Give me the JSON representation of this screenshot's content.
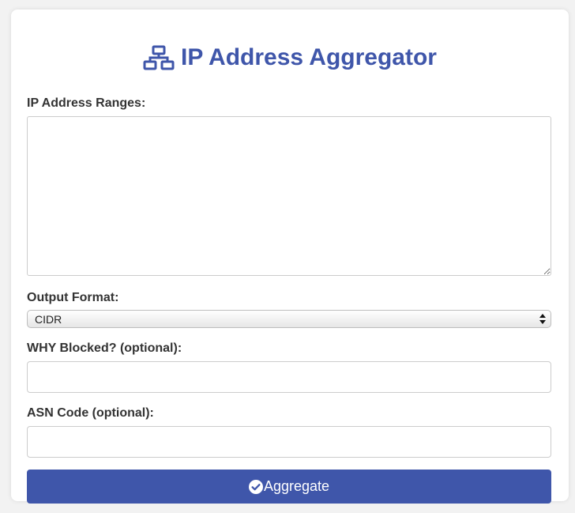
{
  "page": {
    "title": "IP Address Aggregator",
    "title_icon": "network-icon",
    "accent_color": "#3f56aa"
  },
  "form": {
    "ranges": {
      "label": "IP Address Ranges:",
      "value": ""
    },
    "output_format": {
      "label": "Output Format:",
      "selected": "CIDR"
    },
    "why_blocked": {
      "label": "WHY Blocked? (optional):",
      "value": ""
    },
    "asn_code": {
      "label": "ASN Code (optional):",
      "value": ""
    },
    "submit": {
      "label": "Aggregate",
      "icon": "check-circle-icon"
    }
  }
}
